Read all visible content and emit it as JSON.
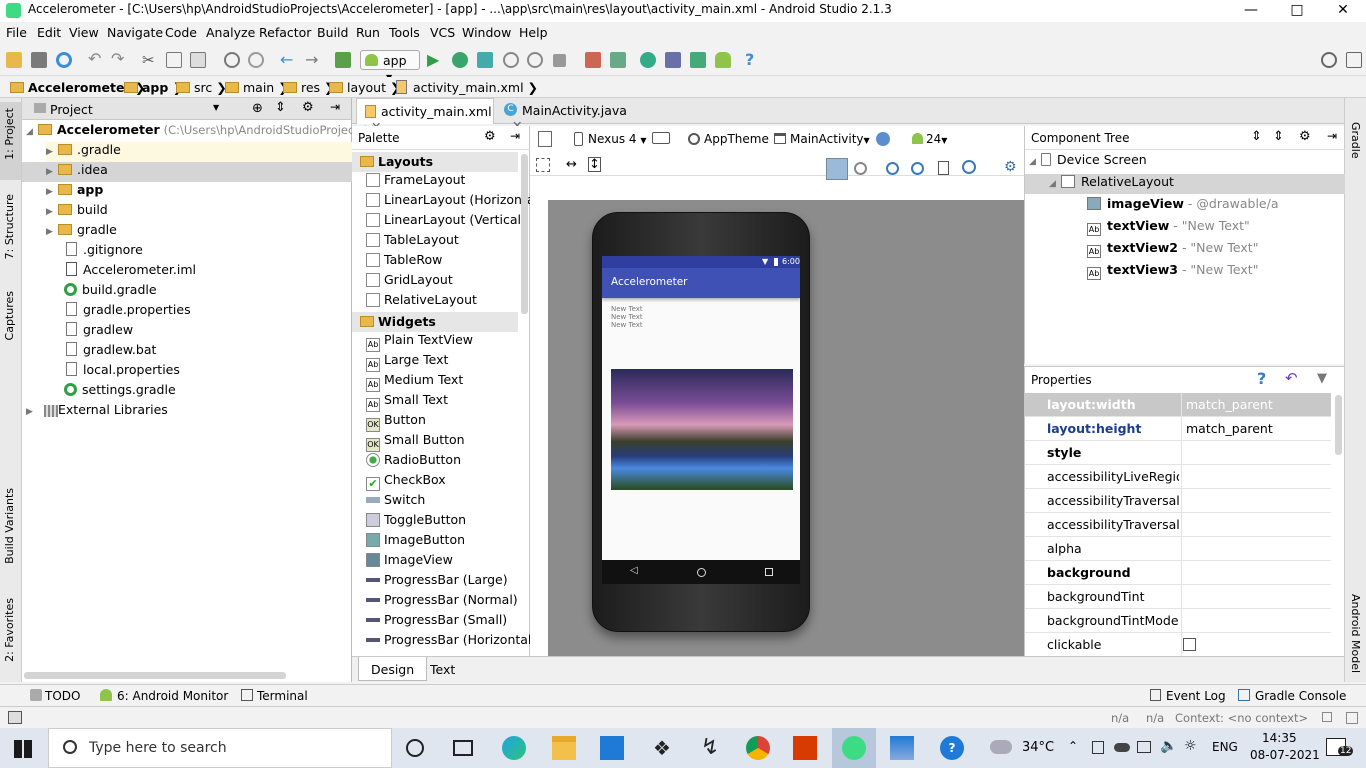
{
  "window": {
    "title": "Accelerometer - [C:\\Users\\hp\\AndroidStudioProjects\\Accelerometer] - [app] - ...\\app\\src\\main\\res\\layout\\activity_main.xml - Android Studio 2.1.3"
  },
  "menu": [
    "File",
    "Edit",
    "View",
    "Navigate",
    "Code",
    "Analyze",
    "Refactor",
    "Build",
    "Run",
    "Tools",
    "VCS",
    "Window",
    "Help"
  ],
  "toolbar": {
    "run_config": "app"
  },
  "breadcrumb": [
    "Accelerometer",
    "app",
    "src",
    "main",
    "res",
    "layout",
    "activity_main.xml"
  ],
  "left_tabs": [
    "1: Project",
    "7: Structure",
    "Captures",
    "Build Variants",
    "2: Favorites"
  ],
  "right_tabs": [
    "Gradle",
    "Android Model"
  ],
  "project": {
    "header": "Project",
    "root": "Accelerometer",
    "root_path": "(C:\\Users\\hp\\AndroidStudioProjects\\A",
    "items": [
      ".gradle",
      ".idea",
      "app",
      "build",
      "gradle",
      ".gitignore",
      "Accelerometer.iml",
      "build.gradle",
      "gradle.properties",
      "gradlew",
      "gradlew.bat",
      "local.properties",
      "settings.gradle"
    ],
    "external": "External Libraries"
  },
  "editor_tabs": [
    "activity_main.xml",
    "MainActivity.java"
  ],
  "palette": {
    "title": "Palette",
    "layouts_label": "Layouts",
    "layouts": [
      "FrameLayout",
      "LinearLayout (Horizontal)",
      "LinearLayout (Vertical)",
      "TableLayout",
      "TableRow",
      "GridLayout",
      "RelativeLayout"
    ],
    "widgets_label": "Widgets",
    "widgets": [
      "Plain TextView",
      "Large Text",
      "Medium Text",
      "Small Text",
      "Button",
      "Small Button",
      "RadioButton",
      "CheckBox",
      "Switch",
      "ToggleButton",
      "ImageButton",
      "ImageView",
      "ProgressBar (Large)",
      "ProgressBar (Normal)",
      "ProgressBar (Small)",
      "ProgressBar (Horizontal)"
    ]
  },
  "design_toolbar": {
    "device": "Nexus 4",
    "theme": "AppTheme",
    "activity": "MainActivity",
    "api": "24"
  },
  "phone": {
    "status_time": "6:00",
    "app_title": "Accelerometer",
    "texts": [
      "New Text",
      "New Text",
      "New Text"
    ]
  },
  "component_tree": {
    "title": "Component Tree",
    "root": "Device Screen",
    "layout": "RelativeLayout",
    "children": [
      {
        "name": "imageView",
        "detail": "- @drawable/a"
      },
      {
        "name": "textView",
        "detail": "- \"New Text\""
      },
      {
        "name": "textView2",
        "detail": "- \"New Text\""
      },
      {
        "name": "textView3",
        "detail": "- \"New Text\""
      }
    ]
  },
  "properties": {
    "title": "Properties",
    "rows": [
      {
        "name": "layout:width",
        "value": "match_parent"
      },
      {
        "name": "layout:height",
        "value": "match_parent"
      },
      {
        "name": "style",
        "value": ""
      },
      {
        "name": "accessibilityLiveRegion",
        "value": ""
      },
      {
        "name": "accessibilityTraversalAfte",
        "value": ""
      },
      {
        "name": "accessibilityTraversalBefc",
        "value": ""
      },
      {
        "name": "alpha",
        "value": ""
      },
      {
        "name": "background",
        "value": ""
      },
      {
        "name": "backgroundTint",
        "value": ""
      },
      {
        "name": "backgroundTintMode",
        "value": ""
      },
      {
        "name": "clickable",
        "value": ""
      }
    ]
  },
  "bottom_tabs": [
    "Design",
    "Text"
  ],
  "tool_windows": {
    "todo": "TODO",
    "monitor": "6: Android Monitor",
    "terminal": "Terminal",
    "event_log": "Event Log",
    "gradle_console": "Gradle Console"
  },
  "status": {
    "na1": "n/a",
    "na2": "n/a",
    "context": "Context: <no context>"
  },
  "taskbar": {
    "search_placeholder": "Type here to search",
    "temp": "34°C",
    "lang": "ENG",
    "time": "14:35",
    "date": "08-07-2021",
    "notifications": "12"
  }
}
